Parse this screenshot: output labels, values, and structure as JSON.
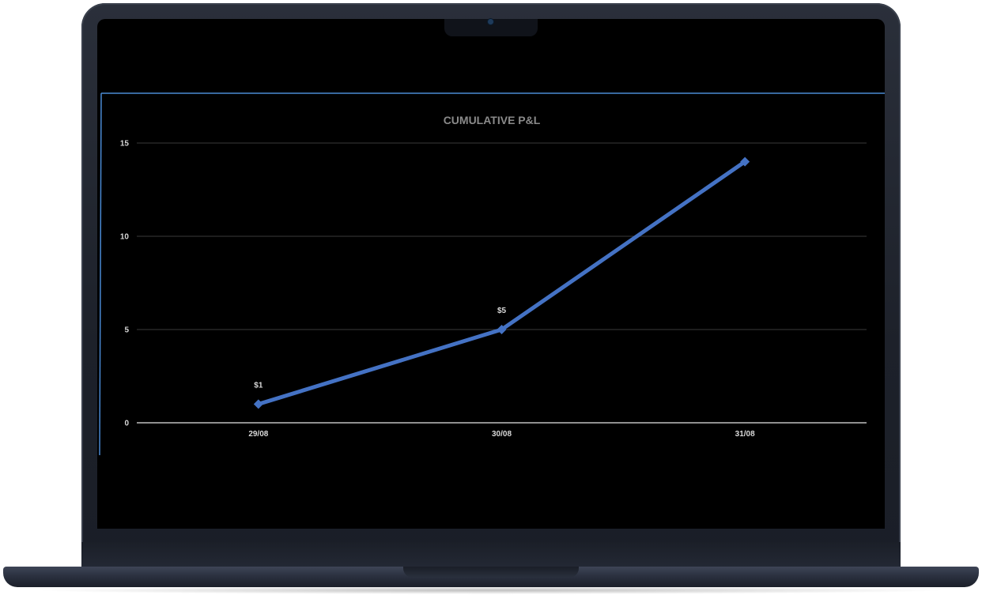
{
  "colors": {
    "series": "#4472c4",
    "frame": "#4a8ad4",
    "gridline": "#3a3a3a",
    "axis": "#bfbfbf",
    "title": "#8a8a8a"
  },
  "chart_data": {
    "type": "line",
    "title": "CUMULATIVE P&L",
    "xlabel": "",
    "ylabel": "",
    "categories": [
      "29/08",
      "30/08",
      "31/08"
    ],
    "series": [
      {
        "values": [
          1,
          5,
          14
        ],
        "marker": "diamond",
        "data_labels": [
          "$1",
          "$5",
          ""
        ]
      }
    ],
    "yticks": [
      "0",
      "5",
      "10",
      "15"
    ],
    "ylim": [
      0,
      15
    ],
    "grid": true,
    "legend": "none"
  }
}
